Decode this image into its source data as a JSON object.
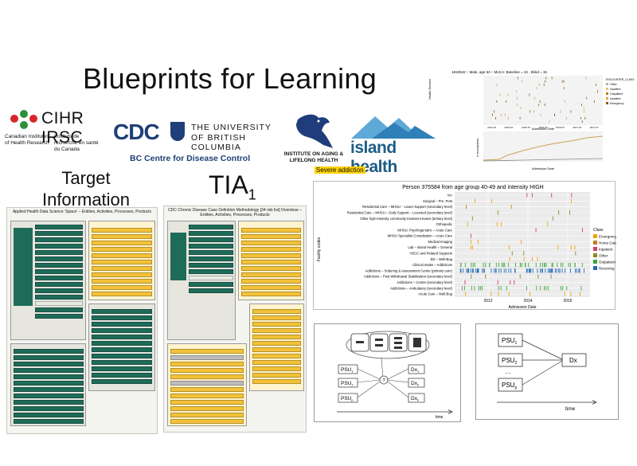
{
  "title": "Blueprints for Learning",
  "logos": {
    "cihr": {
      "name": "CIHR IRSC",
      "en": "Canadian Institutes of Health Research",
      "fr": "Instituts de recherche en santé du Canada"
    },
    "bccdc": {
      "mark": "CDC",
      "name": "BC Centre for Disease Control"
    },
    "ubc": {
      "line1": "THE UNIVERSITY",
      "line2": "OF BRITISH COLUMBIA"
    },
    "iaa": {
      "name": "INSTITUTE ON AGING & LIFELONG HEALTH"
    },
    "island": {
      "name": "island health"
    }
  },
  "sections": {
    "tia_heading": "Target Information Architecture",
    "tia1": "TIA",
    "tia1_sub": "1",
    "severe": "Severe addiction"
  },
  "doc_left": {
    "title": "Applied Health Data Science ‘Space’ – Entities, Activities, Processes, Products"
  },
  "doc_mid": {
    "title": "CDC Chronic Disease Case Definition Methodology [34 risk list] Overdose – Entities, Activities, Processes, Products"
  },
  "small_chart": {
    "title": "1810542 – Male, age 53 – MoCA: Baseline = 22 , Blind = 15",
    "top_xlabel": "Admission Date",
    "bottom_xlabel": "Admission Date",
    "top_ylabel": "Health Service",
    "bottom_ylabel": "# encounters",
    "legend_title": "ENCOUNTER_CLASS",
    "legend": [
      "Other",
      "Inpatient",
      "Outpatient",
      "Inpatient",
      "Emergency"
    ],
    "x_ticks": [
      "2014-07",
      "2015-01",
      "2015-07",
      "2016-01",
      "2016-07",
      "2017-01",
      "2017-07"
    ]
  },
  "main_chart": {
    "title": "Person 375584 from age group 40-49 and intensity HIGH",
    "xlabel": "Admission Date",
    "ylabel": "Facility codes",
    "x_ticks": [
      "2012",
      "2014",
      "2016"
    ],
    "categories": [
      "NA",
      "Surgical – Pre, Post",
      "Residential Care – MHSU – Lower Support (secondary level)",
      "Residential Care – MHSU – Daily Support – Licensed (secondary level)",
      "Other high-intensity community treatment teams (tertiary level)",
      "Orthopedic",
      "MHSU: Psychogeriatric – Acute Care",
      "MHSU Specialist Consultation – Acute Care",
      "Medical Imaging",
      "Lab – Island Health – General",
      "HSCC and Related Supports",
      "ED – Well-Bug",
      "Clinical Intake – Addictions",
      "Addictions – Sobering & Assessment Centre (primary care)",
      "Addictions – Post Withdrawal Stabilization (secondary level)",
      "Addictions – Centre (secondary level)",
      "Addictions – Ambulatory (secondary level)",
      "Acute Care – Well-Bug"
    ],
    "legend_title": "Class",
    "legend": [
      {
        "label": "Emergency",
        "color": "#f2a400"
      },
      {
        "label": "Home Care",
        "color": "#c57b1c"
      },
      {
        "label": "Inpatient",
        "color": "#d23b6b"
      },
      {
        "label": "Other",
        "color": "#8a8a2a"
      },
      {
        "label": "Outpatient",
        "color": "#3aa83a"
      },
      {
        "label": "Recurring",
        "color": "#1f6ab5"
      }
    ]
  },
  "diag1": {
    "inputs": [
      "PSU",
      "PSU",
      "PSU"
    ],
    "input_subs": [
      "1",
      "2",
      "p"
    ],
    "outputs": [
      "Dx",
      "Dx",
      "Dx"
    ],
    "output_subs": [
      "1",
      "2",
      "k"
    ],
    "center": "?",
    "axis": "time"
  },
  "diag2": {
    "inputs": [
      "PSU",
      "PSU",
      "…",
      "PSU"
    ],
    "input_subs": [
      "1",
      "2",
      "",
      "p"
    ],
    "output": "Dx",
    "axis": "time"
  }
}
